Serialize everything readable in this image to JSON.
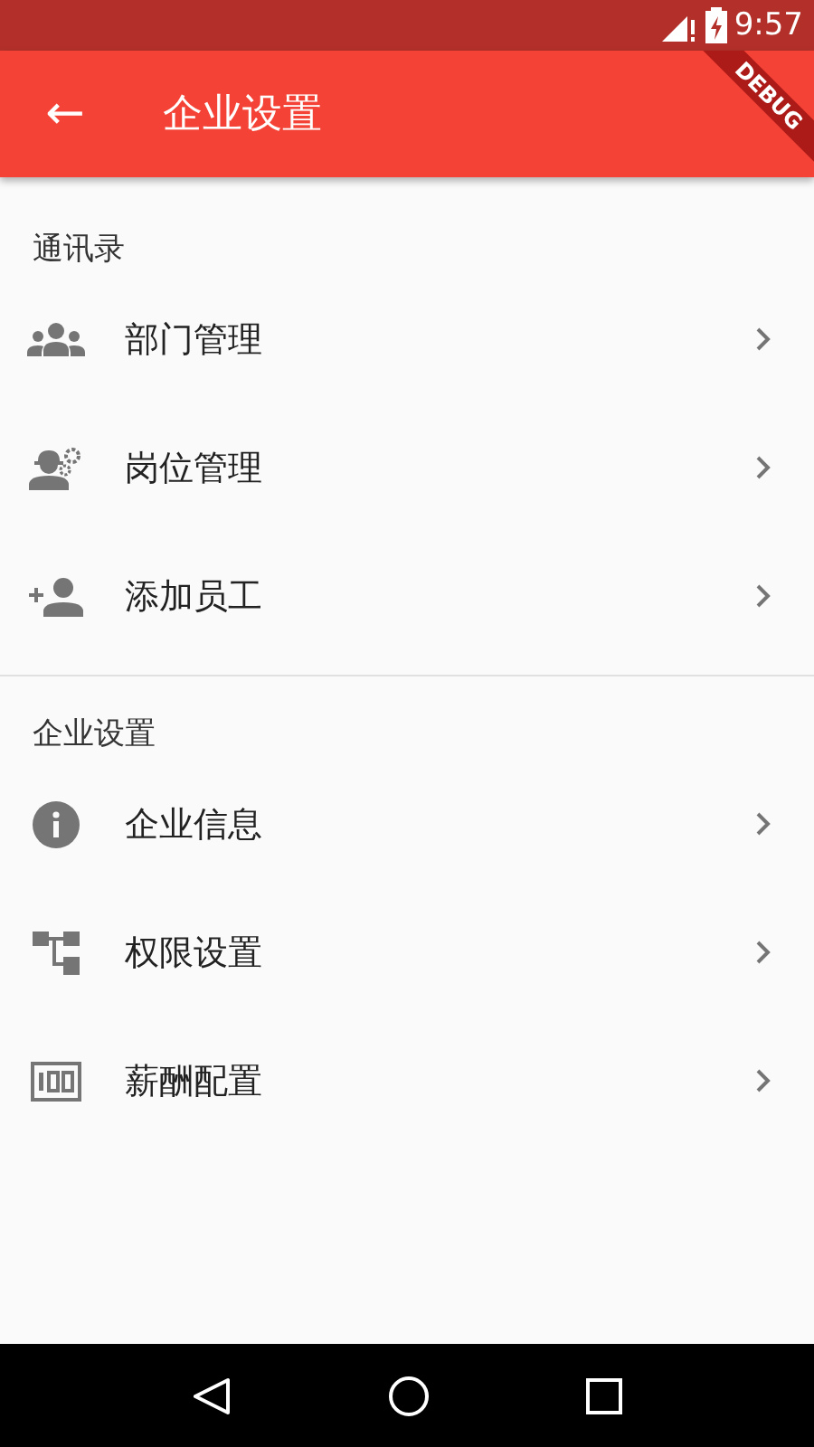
{
  "status_bar": {
    "time": "9:57"
  },
  "debug_banner": "DEBUG",
  "app_bar": {
    "back": "←",
    "title": "企业设置"
  },
  "sections": [
    {
      "title": "通讯录",
      "items": [
        {
          "kind": "group",
          "label": "部门管理"
        },
        {
          "kind": "engineer",
          "label": "岗位管理"
        },
        {
          "kind": "person-add",
          "label": "添加员工"
        }
      ]
    },
    {
      "title": "企业设置",
      "items": [
        {
          "kind": "info",
          "label": "企业信息"
        },
        {
          "kind": "tree",
          "label": "权限设置"
        },
        {
          "kind": "money",
          "label": "薪酬配置"
        }
      ]
    }
  ]
}
